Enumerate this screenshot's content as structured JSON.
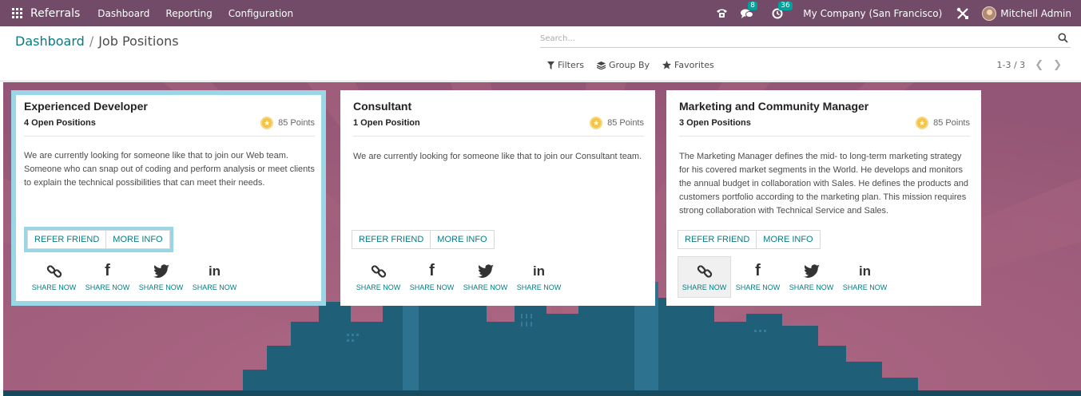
{
  "navbar": {
    "app_name": "Referrals",
    "menu": [
      "Dashboard",
      "Reporting",
      "Configuration"
    ],
    "messages_count": "8",
    "activities_count": "36",
    "company": "My Company (San Francisco)",
    "user": "Mitchell Admin"
  },
  "breadcrumb": {
    "parent": "Dashboard",
    "separator": "/",
    "current": "Job Positions"
  },
  "search": {
    "placeholder": "Search..."
  },
  "filters": {
    "filters_label": "Filters",
    "group_by_label": "Group By",
    "favorites_label": "Favorites"
  },
  "pager": {
    "value": "1-3 / 3"
  },
  "cards": [
    {
      "title": "Experienced Developer",
      "open_positions": "4 Open Positions",
      "points": "85 Points",
      "description": "We are currently looking for someone like that to join our Web team. Someone who can snap out of coding and perform analysis or meet clients to explain the technical possibilities that can meet their needs.",
      "refer_label": "REFER FRIEND",
      "info_label": "MORE INFO",
      "share_label": "SHARE NOW"
    },
    {
      "title": "Consultant",
      "open_positions": "1 Open Position",
      "points": "85 Points",
      "description": "We are currently looking for someone like that to join our Consultant team.",
      "refer_label": "REFER FRIEND",
      "info_label": "MORE INFO",
      "share_label": "SHARE NOW"
    },
    {
      "title": "Marketing and Community Manager",
      "open_positions": "3 Open Positions",
      "points": "85 Points",
      "description": "The Marketing Manager defines the mid- to long-term marketing strategy for his covered market segments in the World. He develops and monitors the annual budget in collaboration with Sales. He defines the products and customers portfolio according to the marketing plan. This mission requires strong collaboration with Technical Service and Sales.",
      "refer_label": "REFER FRIEND",
      "info_label": "MORE INFO",
      "share_label": "SHARE NOW"
    }
  ],
  "colors": {
    "navbar": "#714b67",
    "link": "#017e84",
    "background": "#9b5d7b",
    "selection": "#9ad6e5",
    "coin": "#f6c343"
  }
}
